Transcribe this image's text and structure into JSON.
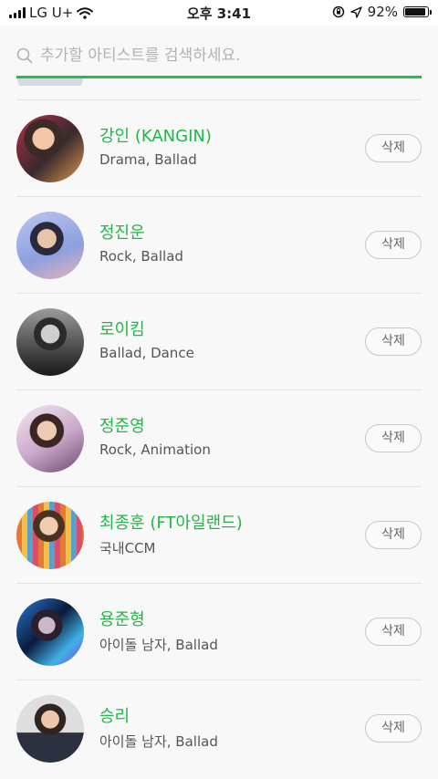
{
  "status_bar": {
    "carrier": "LG U+",
    "time": "오후 3:41",
    "battery_percent": "92%",
    "battery_level": 0.92
  },
  "search": {
    "placeholder": "추가할 아티스트를 검색하세요.",
    "value": ""
  },
  "colors": {
    "accent": "#21c149",
    "name_text": "#21b746"
  },
  "artists": [
    {
      "name": "강인 (KANGIN)",
      "genre": "Drama, Ballad",
      "delete_label": "삭제"
    },
    {
      "name": "정진운",
      "genre": "Rock, Ballad",
      "delete_label": "삭제"
    },
    {
      "name": "로이킴",
      "genre": "Ballad, Dance",
      "delete_label": "삭제"
    },
    {
      "name": "정준영",
      "genre": "Rock, Animation",
      "delete_label": "삭제"
    },
    {
      "name": "최종훈 (FT아일랜드)",
      "genre": "국내CCM",
      "delete_label": "삭제"
    },
    {
      "name": "용준형",
      "genre": "아이돌 남자, Ballad",
      "delete_label": "삭제"
    },
    {
      "name": "승리",
      "genre": "아이돌 남자, Ballad",
      "delete_label": "삭제"
    }
  ]
}
